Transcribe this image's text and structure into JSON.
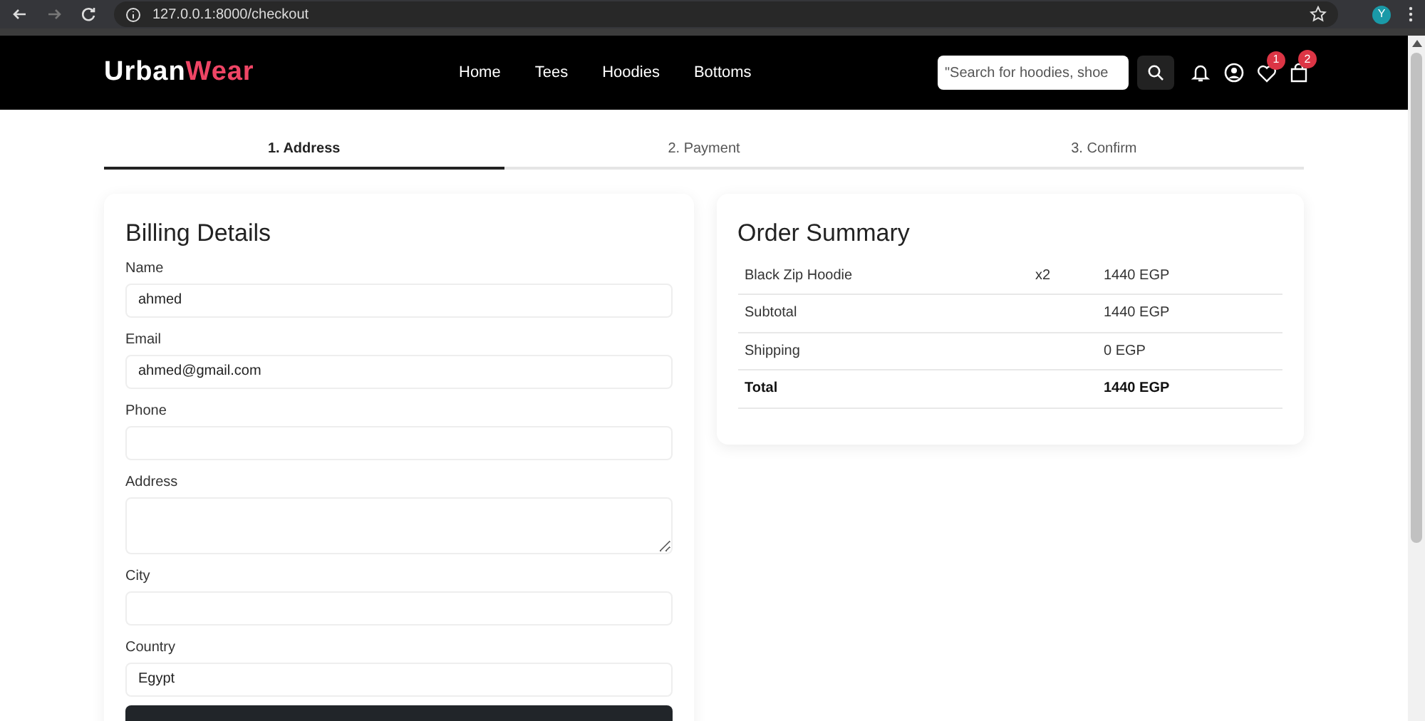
{
  "browser": {
    "url": "127.0.0.1:8000/checkout",
    "profile_initial": "Y"
  },
  "navbar": {
    "logo": [
      "Urban",
      "Wear"
    ],
    "links": [
      "Home",
      "Tees",
      "Hoodies",
      "Bottoms"
    ],
    "search": {
      "placeholder": "\"Search for hoodies, shoe"
    },
    "wishlist_count": "1",
    "cart_count": "2"
  },
  "steps": [
    {
      "label": "1. Address",
      "selected": true
    },
    {
      "label": "2. Payment",
      "selected": false
    },
    {
      "label": "3. Confirm",
      "selected": false
    }
  ],
  "billing": {
    "title": "Billing Details",
    "fields": [
      {
        "label": "Name",
        "kind": "input",
        "value": "ahmed"
      },
      {
        "label": "Email",
        "kind": "input",
        "value": "ahmed@gmail.com"
      },
      {
        "label": "Phone",
        "kind": "input"
      },
      {
        "label": "Address",
        "kind": "textarea"
      },
      {
        "label": "City",
        "kind": "input"
      },
      {
        "label": "Country",
        "kind": "input",
        "value": "Egypt"
      }
    ]
  },
  "order_summary": {
    "title": "Order Summary",
    "rows": [
      {
        "kind": "item",
        "label": "Black Zip Hoodie",
        "qty": "x2",
        "amount": "1440 EGP"
      },
      {
        "kind": "line",
        "label": "Subtotal",
        "amount": "1440 EGP"
      },
      {
        "kind": "line",
        "label": "Shipping",
        "amount": "0 EGP"
      },
      {
        "kind": "total",
        "label": "Total",
        "amount": "1440 EGP"
      }
    ]
  }
}
